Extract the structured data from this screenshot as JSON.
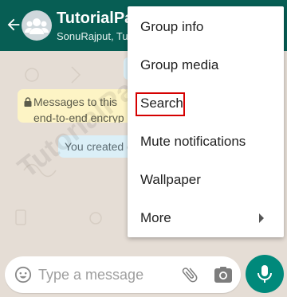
{
  "header": {
    "title": "TutorialPan",
    "subtitle": "SonuRajput, Tut",
    "bg_color": "#075e54"
  },
  "chat": {
    "system_message_line1": "Messages to this",
    "system_message_line2": "end-to-end encryp",
    "created_message": "You created g"
  },
  "menu": {
    "items": [
      {
        "label": "Group info"
      },
      {
        "label": "Group media"
      },
      {
        "label": "Search",
        "highlighted": true
      },
      {
        "label": "Mute notifications"
      },
      {
        "label": "Wallpaper"
      },
      {
        "label": "More",
        "has_submenu": true
      }
    ]
  },
  "composer": {
    "placeholder": "Type a message",
    "mic_color": "#00897b"
  },
  "watermark": "TutorialPandit.com",
  "icons": [
    "back-arrow-icon",
    "group-avatar-icon",
    "lock-icon",
    "emoji-icon",
    "attach-icon",
    "camera-icon",
    "mic-icon",
    "chevron-right-icon"
  ]
}
